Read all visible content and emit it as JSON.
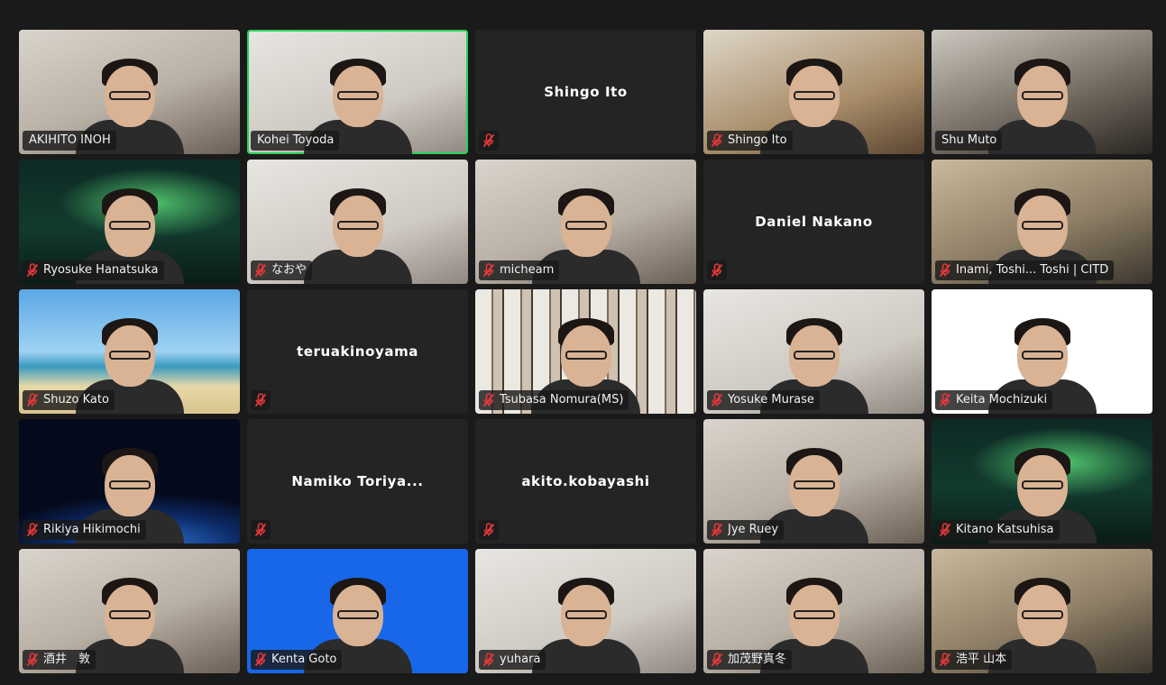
{
  "meeting": {
    "participants": [
      {
        "name": "AKIHITO INOH",
        "video": true,
        "muted": false,
        "speaking": false,
        "bg": "room"
      },
      {
        "name": "Kohei Toyoda",
        "video": true,
        "muted": false,
        "speaking": true,
        "bg": "room3"
      },
      {
        "name": "Shingo Ito",
        "video": false,
        "muted": true,
        "speaking": false,
        "display_name": "Shingo Ito"
      },
      {
        "name": "Shingo Ito",
        "video": true,
        "muted": true,
        "speaking": false,
        "bg": "wood"
      },
      {
        "name": "Shu Muto",
        "video": true,
        "muted": false,
        "speaking": false,
        "bg": "dark"
      },
      {
        "name": "Ryosuke Hanatsuka",
        "video": true,
        "muted": true,
        "speaking": false,
        "bg": "aurora"
      },
      {
        "name": "なおや",
        "video": true,
        "muted": true,
        "speaking": false,
        "bg": "room3"
      },
      {
        "name": "micheam",
        "video": true,
        "muted": true,
        "speaking": false,
        "bg": "room"
      },
      {
        "name": "Daniel Nakano",
        "video": false,
        "muted": true,
        "speaking": false,
        "display_name": "Daniel Nakano"
      },
      {
        "name": "Inami, Toshi... Toshi | CITD",
        "video": true,
        "muted": true,
        "speaking": false,
        "bg": "room2"
      },
      {
        "name": "Shuzo Kato",
        "video": true,
        "muted": true,
        "speaking": false,
        "bg": "beach"
      },
      {
        "name": "teruakinoyama",
        "video": false,
        "muted": true,
        "speaking": false,
        "display_name": "teruakinoyama"
      },
      {
        "name": "Tsubasa Nomura(MS)",
        "video": true,
        "muted": true,
        "speaking": false,
        "bg": "shelf"
      },
      {
        "name": "Yosuke Murase",
        "video": true,
        "muted": true,
        "speaking": false,
        "bg": "room3"
      },
      {
        "name": "Keita Mochizuki",
        "video": true,
        "muted": true,
        "speaking": false,
        "bg": "logo"
      },
      {
        "name": "Rikiya Hikimochi",
        "video": true,
        "muted": true,
        "speaking": false,
        "bg": "space"
      },
      {
        "name": "Namiko Toriya...",
        "video": false,
        "muted": true,
        "speaking": false,
        "display_name": "Namiko Toriya..."
      },
      {
        "name": "akito.kobayashi",
        "video": false,
        "muted": true,
        "speaking": false,
        "display_name": "akito.kobayashi"
      },
      {
        "name": "Jye Ruey",
        "video": true,
        "muted": true,
        "speaking": false,
        "bg": "room"
      },
      {
        "name": "Kitano Katsuhisa",
        "video": true,
        "muted": true,
        "speaking": false,
        "bg": "aurora"
      },
      {
        "name": "酒井　敦",
        "video": true,
        "muted": true,
        "speaking": false,
        "bg": "room"
      },
      {
        "name": "Kenta Goto",
        "video": true,
        "muted": true,
        "speaking": false,
        "bg": "blue"
      },
      {
        "name": "yuhara",
        "video": true,
        "muted": true,
        "speaking": false,
        "bg": "room3"
      },
      {
        "name": "加茂野真冬",
        "video": true,
        "muted": true,
        "speaking": false,
        "bg": "room"
      },
      {
        "name": "浩平 山本",
        "video": true,
        "muted": true,
        "speaking": false,
        "bg": "room2"
      }
    ]
  },
  "colors": {
    "background": "#1a1a1a",
    "tile": "#242424",
    "speaking_border": "#2bd15a",
    "muted_icon": "#e5383b",
    "label_text": "#f2f2f2"
  },
  "icons": {
    "muted": "microphone-muted-icon"
  }
}
